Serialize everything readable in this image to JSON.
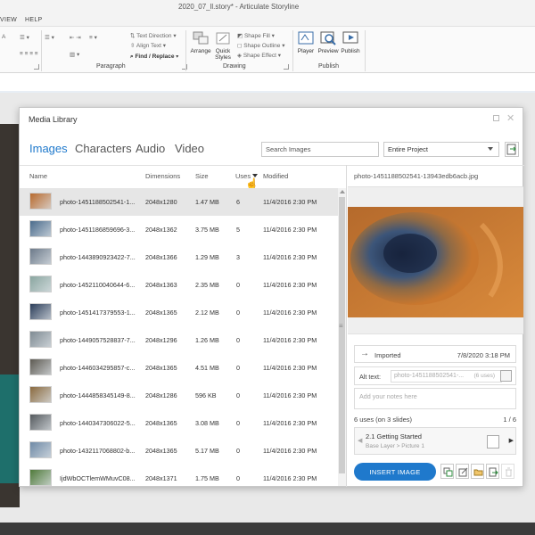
{
  "app": {
    "window_title": "2020_07_ll.story* - Articulate Storyline",
    "menu": {
      "view_label": "VIEW",
      "help_label": "HELP"
    }
  },
  "ribbon": {
    "text_direction": "Text Direction",
    "align_text": "Align Text",
    "find_replace": "Find / Replace",
    "paragraph_group": "Paragraph",
    "arrange": "Arrange",
    "quick_styles": "Quick Styles",
    "shape_fill": "Shape Fill",
    "shape_outline": "Shape Outline",
    "shape_effect": "Shape Effect",
    "drawing_group": "Drawing",
    "player": "Player",
    "preview": "Preview",
    "publish": "Publish",
    "publish_group": "Publish"
  },
  "dialog": {
    "title": "Media Library",
    "tabs": [
      "Images",
      "Characters",
      "Audio",
      "Video"
    ],
    "active_tab": "Images",
    "search": {
      "placeholder": "Search Images"
    },
    "scope": {
      "value": "Entire Project"
    },
    "columns": {
      "name": "Name",
      "dimensions": "Dimensions",
      "size": "Size",
      "uses": "Uses",
      "modified": "Modified"
    },
    "rows": [
      {
        "name": "photo-1451188502541-1...",
        "dimensions": "2048x1280",
        "size": "1.47 MB",
        "uses": "6",
        "modified": "11/4/2016 2:30 PM",
        "color": "#b86a2e"
      },
      {
        "name": "photo-1451186859696-3...",
        "dimensions": "2048x1362",
        "size": "3.75 MB",
        "uses": "5",
        "modified": "11/4/2016 2:30 PM",
        "color": "#4a6b8c"
      },
      {
        "name": "photo-1443890923422-7...",
        "dimensions": "2048x1366",
        "size": "1.29 MB",
        "uses": "3",
        "modified": "11/4/2016 2:30 PM",
        "color": "#6c7a8a"
      },
      {
        "name": "photo-1452110040644-6...",
        "dimensions": "2048x1363",
        "size": "2.35 MB",
        "uses": "0",
        "modified": "11/4/2016 2:30 PM",
        "color": "#8aa6a0"
      },
      {
        "name": "photo-1451417379553-1...",
        "dimensions": "2048x1365",
        "size": "2.12 MB",
        "uses": "0",
        "modified": "11/4/2016 2:30 PM",
        "color": "#2c3e5a"
      },
      {
        "name": "photo-1449057528837-7...",
        "dimensions": "2048x1296",
        "size": "1.26 MB",
        "uses": "0",
        "modified": "11/4/2016 2:30 PM",
        "color": "#7f8b93"
      },
      {
        "name": "photo-1446034295857-c...",
        "dimensions": "2048x1365",
        "size": "4.51 MB",
        "uses": "0",
        "modified": "11/4/2016 2:30 PM",
        "color": "#5d5a52"
      },
      {
        "name": "photo-1444858345149-8...",
        "dimensions": "2048x1286",
        "size": "596 KB",
        "uses": "0",
        "modified": "11/4/2016 2:30 PM",
        "color": "#8a6a3f"
      },
      {
        "name": "photo-1440347306022-5...",
        "dimensions": "2048x1365",
        "size": "3.08 MB",
        "uses": "0",
        "modified": "11/4/2016 2:30 PM",
        "color": "#555a5e"
      },
      {
        "name": "photo-1432117068802-b...",
        "dimensions": "2048x1365",
        "size": "5.17 MB",
        "uses": "0",
        "modified": "11/4/2016 2:30 PM",
        "color": "#6f8aa6"
      },
      {
        "name": "IjdWbOCTlemWMuvC08...",
        "dimensions": "2048x1371",
        "size": "1.75 MB",
        "uses": "0",
        "modified": "11/4/2016 2:30 PM",
        "color": "#4f7a3a"
      }
    ],
    "preview": {
      "filename": "photo-1451188502541-13943edb6acb.jpg",
      "imported_label": "Imported",
      "imported_date": "7/8/2020 3:18 PM",
      "alt_text_label": "Alt text:",
      "alt_text_value": "photo-1451188502541-...",
      "alt_text_uses": "(6 uses)",
      "notes_placeholder": "Add your notes here",
      "uses_summary": "6 uses (on 3 slides)",
      "uses_page": "1 / 6",
      "slide_title": "2.1 Getting Started",
      "slide_path": "Base Layer > Picture 1",
      "insert_button": "INSERT IMAGE"
    }
  },
  "colors": {
    "accent": "#1f79cc",
    "selected_row": "#e6e6e6"
  }
}
